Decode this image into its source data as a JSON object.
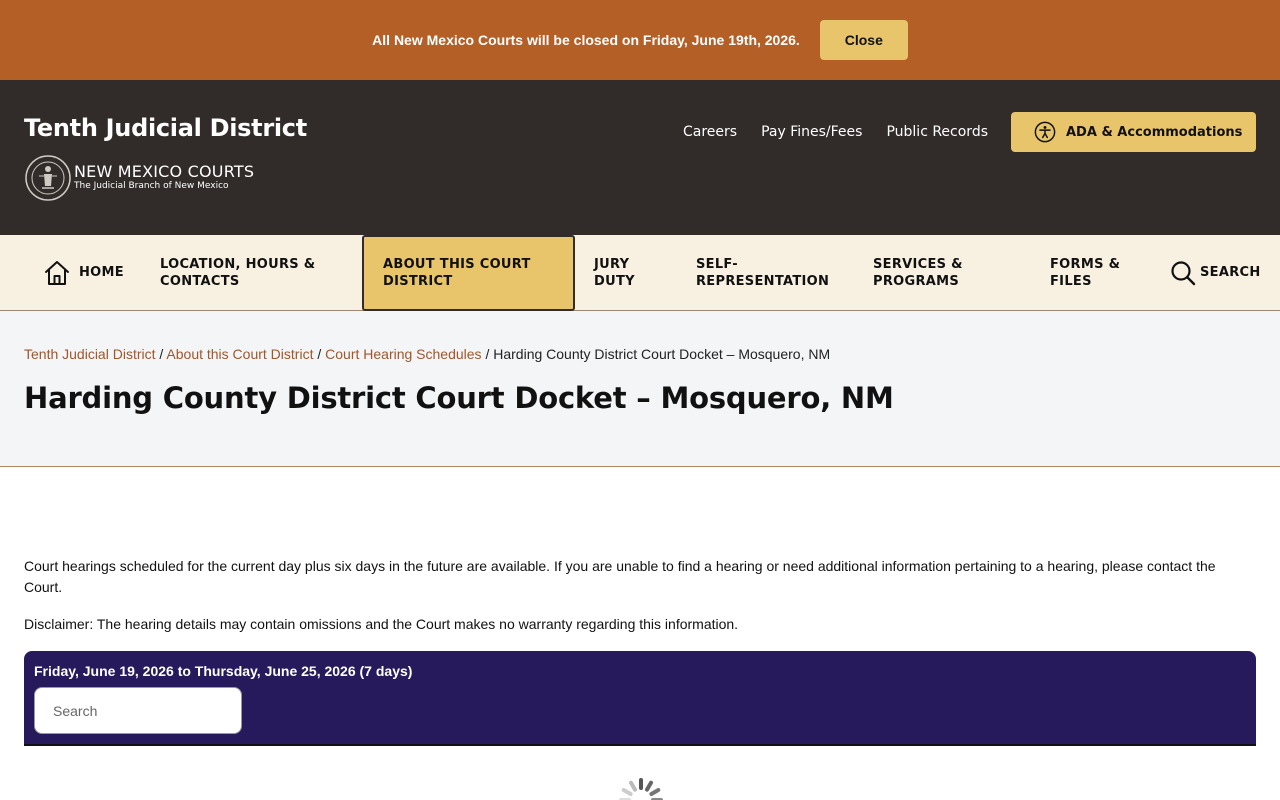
{
  "alert": {
    "message": "All New Mexico Courts will be closed on Friday, June 19th, 2026.",
    "close_label": "Close"
  },
  "header": {
    "site_title": "Tenth Judicial District",
    "brand_name": "NEW MEXICO COURTS",
    "brand_tagline": "The Judicial Branch of New Mexico",
    "links": [
      "Careers",
      "Pay Fines/Fees",
      "Public Records"
    ],
    "ada_label": "ADA & Accommodations"
  },
  "nav": {
    "home": "HOME",
    "location": "LOCATION, HOURS & CONTACTS",
    "about": "ABOUT THIS COURT DISTRICT",
    "jury": "JURY DUTY",
    "self_rep": "SELF-REPRESENTATION",
    "services": "SERVICES & PROGRAMS",
    "forms": "FORMS & FILES",
    "search": "SEARCH"
  },
  "breadcrumb": {
    "items": [
      "Tenth Judicial District",
      "About this Court District",
      "Court Hearing Schedules"
    ],
    "current": "Harding County District Court Docket – Mosquero, NM"
  },
  "page": {
    "title": "Harding County District Court Docket – Mosquero, NM",
    "intro": "Court hearings scheduled for the current day plus six days in the future are available. If you are unable to find a hearing or need additional information pertaining to a hearing, please contact the Court.",
    "disclaimer": "Disclaimer:  The hearing details may contain omissions and the Court makes no warranty regarding this information."
  },
  "docket": {
    "range": "Friday, June 19, 2026 to Thursday, June 25, 2026 (7 days)",
    "search_placeholder": "Search"
  },
  "colors": {
    "alert_bg": "#b45f26",
    "header_bg": "#312c29",
    "accent": "#e8c56a",
    "nav_bg": "#f8f1e2",
    "docket_bg": "#261a5c",
    "link": "#a0572a"
  }
}
